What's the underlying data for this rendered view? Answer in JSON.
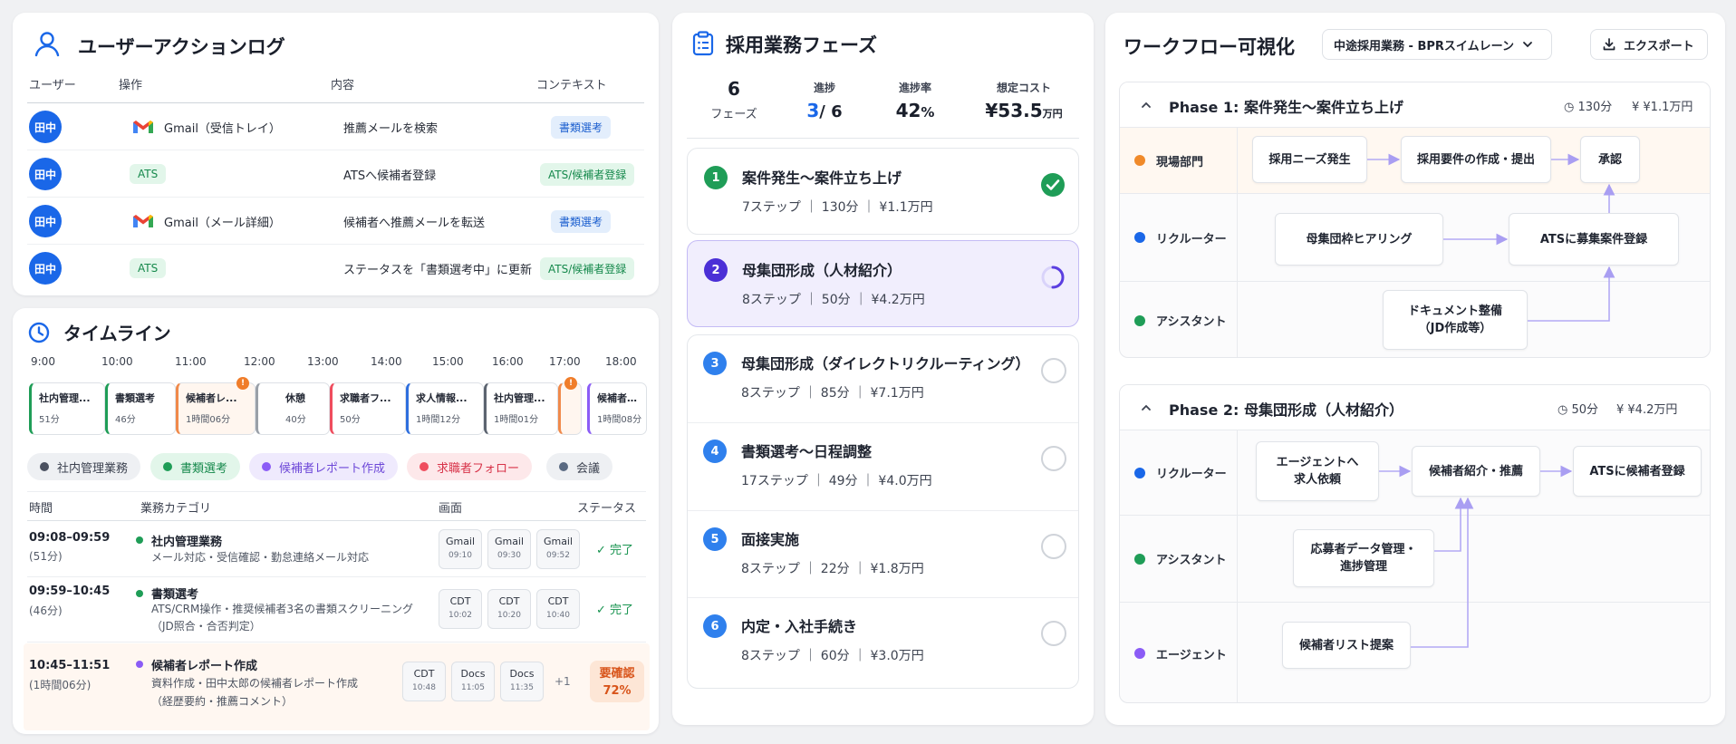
{
  "action_log": {
    "title": "ユーザーアクションログ",
    "headers": [
      "ユーザー",
      "操作",
      "内容",
      "コンテキスト"
    ],
    "rows": [
      {
        "user": "田中",
        "operation": "Gmail（受信トレイ）",
        "content": "推薦メールを検索",
        "context": "書類選考"
      },
      {
        "user": "田中",
        "operation": "ATS",
        "content": "ATSへ候補者登録",
        "context": "ATS/候補者登録"
      },
      {
        "user": "田中",
        "operation": "Gmail（メール詳細）",
        "content": "候補者へ推薦メールを転送",
        "context": "書類選考"
      },
      {
        "user": "田中",
        "operation": "ATS",
        "content": "ステータスを「書類選考中」に更新",
        "context": "ATS/候補者登録"
      }
    ]
  },
  "timeline": {
    "title": "タイムライン",
    "hours": [
      "9:00",
      "10:00",
      "11:00",
      "12:00",
      "13:00",
      "14:00",
      "15:00",
      "16:00",
      "17:00",
      "18:00"
    ],
    "blocks": [
      {
        "label": "社内管理...",
        "duration": "51分",
        "color": "#1f9d57"
      },
      {
        "label": "書類選考",
        "duration": "46分",
        "color": "#1f9d57"
      },
      {
        "label": "候補者レ...",
        "duration": "1時間06分",
        "color": "#f08a4b",
        "warn": "!"
      },
      {
        "label": "休憩",
        "duration": "40分",
        "color": "#9aa0a8"
      },
      {
        "label": "求職者フ...",
        "duration": "50分",
        "color": "#ef4d5e"
      },
      {
        "label": "求人情報...",
        "duration": "1時間12分",
        "color": "#2f6fde"
      },
      {
        "label": "社内管理...",
        "duration": "1時間01分",
        "color": "#5c6470"
      },
      {
        "label": "",
        "duration": "",
        "color": "#f08a4b",
        "warn": "!"
      },
      {
        "label": "候補者レ...",
        "duration": "1時間08分",
        "color": "#8b5cf6"
      }
    ],
    "legend": [
      {
        "label": "社内管理業務",
        "color": "#4b5160",
        "bg": "#eef0f3",
        "text": "#3c4250"
      },
      {
        "label": "書類選考",
        "color": "#1f9d57",
        "bg": "#e2f6ea",
        "text": "#16894c"
      },
      {
        "label": "候補者レポート作成",
        "color": "#8b5cf6",
        "bg": "#efeafd",
        "text": "#6d48d8"
      },
      {
        "label": "求職者フォロー",
        "color": "#ef4d5e",
        "bg": "#fde8ea",
        "text": "#d8344a"
      },
      {
        "label": "会議",
        "color": "#5a6a82",
        "bg": "#eef0f3",
        "text": "#3c4250"
      }
    ],
    "table_headers": [
      "時間",
      "業務カテゴリ",
      "画面",
      "ステータス"
    ],
    "rows": [
      {
        "time": "09:08–09:59",
        "duration": "(51分)",
        "category": "社内管理業務",
        "dot": "#1f9d57",
        "desc": [
          "メール対応・受信確認・勤怠連絡メール対応"
        ],
        "screens": [
          {
            "name": "Gmail",
            "time": "09:10"
          },
          {
            "name": "Gmail",
            "time": "09:30"
          },
          {
            "name": "Gmail",
            "time": "09:52"
          }
        ],
        "status": "完了"
      },
      {
        "time": "09:59–10:45",
        "duration": "(46分)",
        "category": "書類選考",
        "dot": "#1f9d57",
        "desc": [
          "ATS/CRM操作・推奨候補者3名の書類スクリーニング",
          "（JD照合・合否判定）"
        ],
        "screens": [
          {
            "name": "CDT",
            "time": "10:02"
          },
          {
            "name": "CDT",
            "time": "10:20"
          },
          {
            "name": "CDT",
            "time": "10:40"
          }
        ],
        "status": "完了"
      },
      {
        "time": "10:45–11:51",
        "duration": "(1時間06分)",
        "category": "候補者レポート作成",
        "dot": "#8b5cf6",
        "desc": [
          "資料作成・田中太郎の候補者レポート作成",
          "（経歴要約・推薦コメント）"
        ],
        "screens": [
          {
            "name": "CDT",
            "time": "10:48"
          },
          {
            "name": "Docs",
            "time": "11:05"
          },
          {
            "name": "Docs",
            "time": "11:35"
          }
        ],
        "more": "+1",
        "status_review": "要確認",
        "progress": "72%"
      }
    ]
  },
  "phases": {
    "title": "採用業務フェーズ",
    "stats": {
      "phase_count": "6",
      "phase_label": "フェーズ",
      "progress_label": "進捗",
      "progress_done": "3",
      "progress_total": "/ 6",
      "rate_label": "進捗率",
      "rate_value": "42",
      "rate_unit": "%",
      "cost_label": "想定コスト",
      "cost_value": "¥53.5",
      "cost_unit": "万円"
    },
    "items": [
      {
        "num": "1",
        "title": "案件発生〜案件立ち上げ",
        "meta": "7ステップ ｜ 130分 ｜ ¥1.1万円",
        "state": "done",
        "color": "#1f9d57"
      },
      {
        "num": "2",
        "title": "母集団形成（人材紹介）",
        "meta": "8ステップ ｜ 50分 ｜ ¥4.2万円",
        "state": "active",
        "color": "#4b2fd6"
      },
      {
        "num": "3",
        "title": "母集団形成（ダイレクトリクルーティング）",
        "meta": "8ステップ ｜ 85分 ｜ ¥7.1万円",
        "state": "todo",
        "color": "#2f80ed"
      },
      {
        "num": "4",
        "title": "書類選考〜日程調整",
        "meta": "17ステップ ｜ 49分 ｜ ¥4.0万円",
        "state": "todo",
        "color": "#2f80ed"
      },
      {
        "num": "5",
        "title": "面接実施",
        "meta": "8ステップ ｜ 22分 ｜ ¥1.8万円",
        "state": "todo",
        "color": "#2f80ed"
      },
      {
        "num": "6",
        "title": "内定・入社手続き",
        "meta": "8ステップ ｜ 60分 ｜ ¥3.0万円",
        "state": "todo",
        "color": "#2f80ed"
      }
    ]
  },
  "workflow": {
    "title": "ワークフロー可視化",
    "selector": "中途採用業務 - BPRスイムレーン",
    "export": "エクスポート",
    "phase1": {
      "title": "Phase 1: 案件発生〜案件立ち上げ",
      "time": "130分",
      "cost": "¥1.1万円",
      "lanes": [
        {
          "name": "現場部門",
          "color": "#f08a2a"
        },
        {
          "name": "リクルーター",
          "color": "#1a67e8"
        },
        {
          "name": "アシスタント",
          "color": "#1f9d57"
        }
      ],
      "nodes": [
        "採用ニーズ発生",
        "採用要件の作成・提出",
        "承認",
        "母集団枠ヒアリング",
        "ATSに募集案件登録",
        "ドキュメント整備\n（JD作成等）"
      ]
    },
    "phase2": {
      "title": "Phase 2: 母集団形成（人材紹介）",
      "time": "50分",
      "cost": "¥4.2万円",
      "lanes": [
        {
          "name": "リクルーター",
          "color": "#1a67e8"
        },
        {
          "name": "アシスタント",
          "color": "#1f9d57"
        },
        {
          "name": "エージェント",
          "color": "#8b5cf6"
        }
      ],
      "nodes": [
        "エージェントへ\n求人依頼",
        "候補者紹介・推薦",
        "ATSに候補者登録",
        "応募者データ管理・\n進捗管理",
        "候補者リスト提案"
      ]
    }
  }
}
